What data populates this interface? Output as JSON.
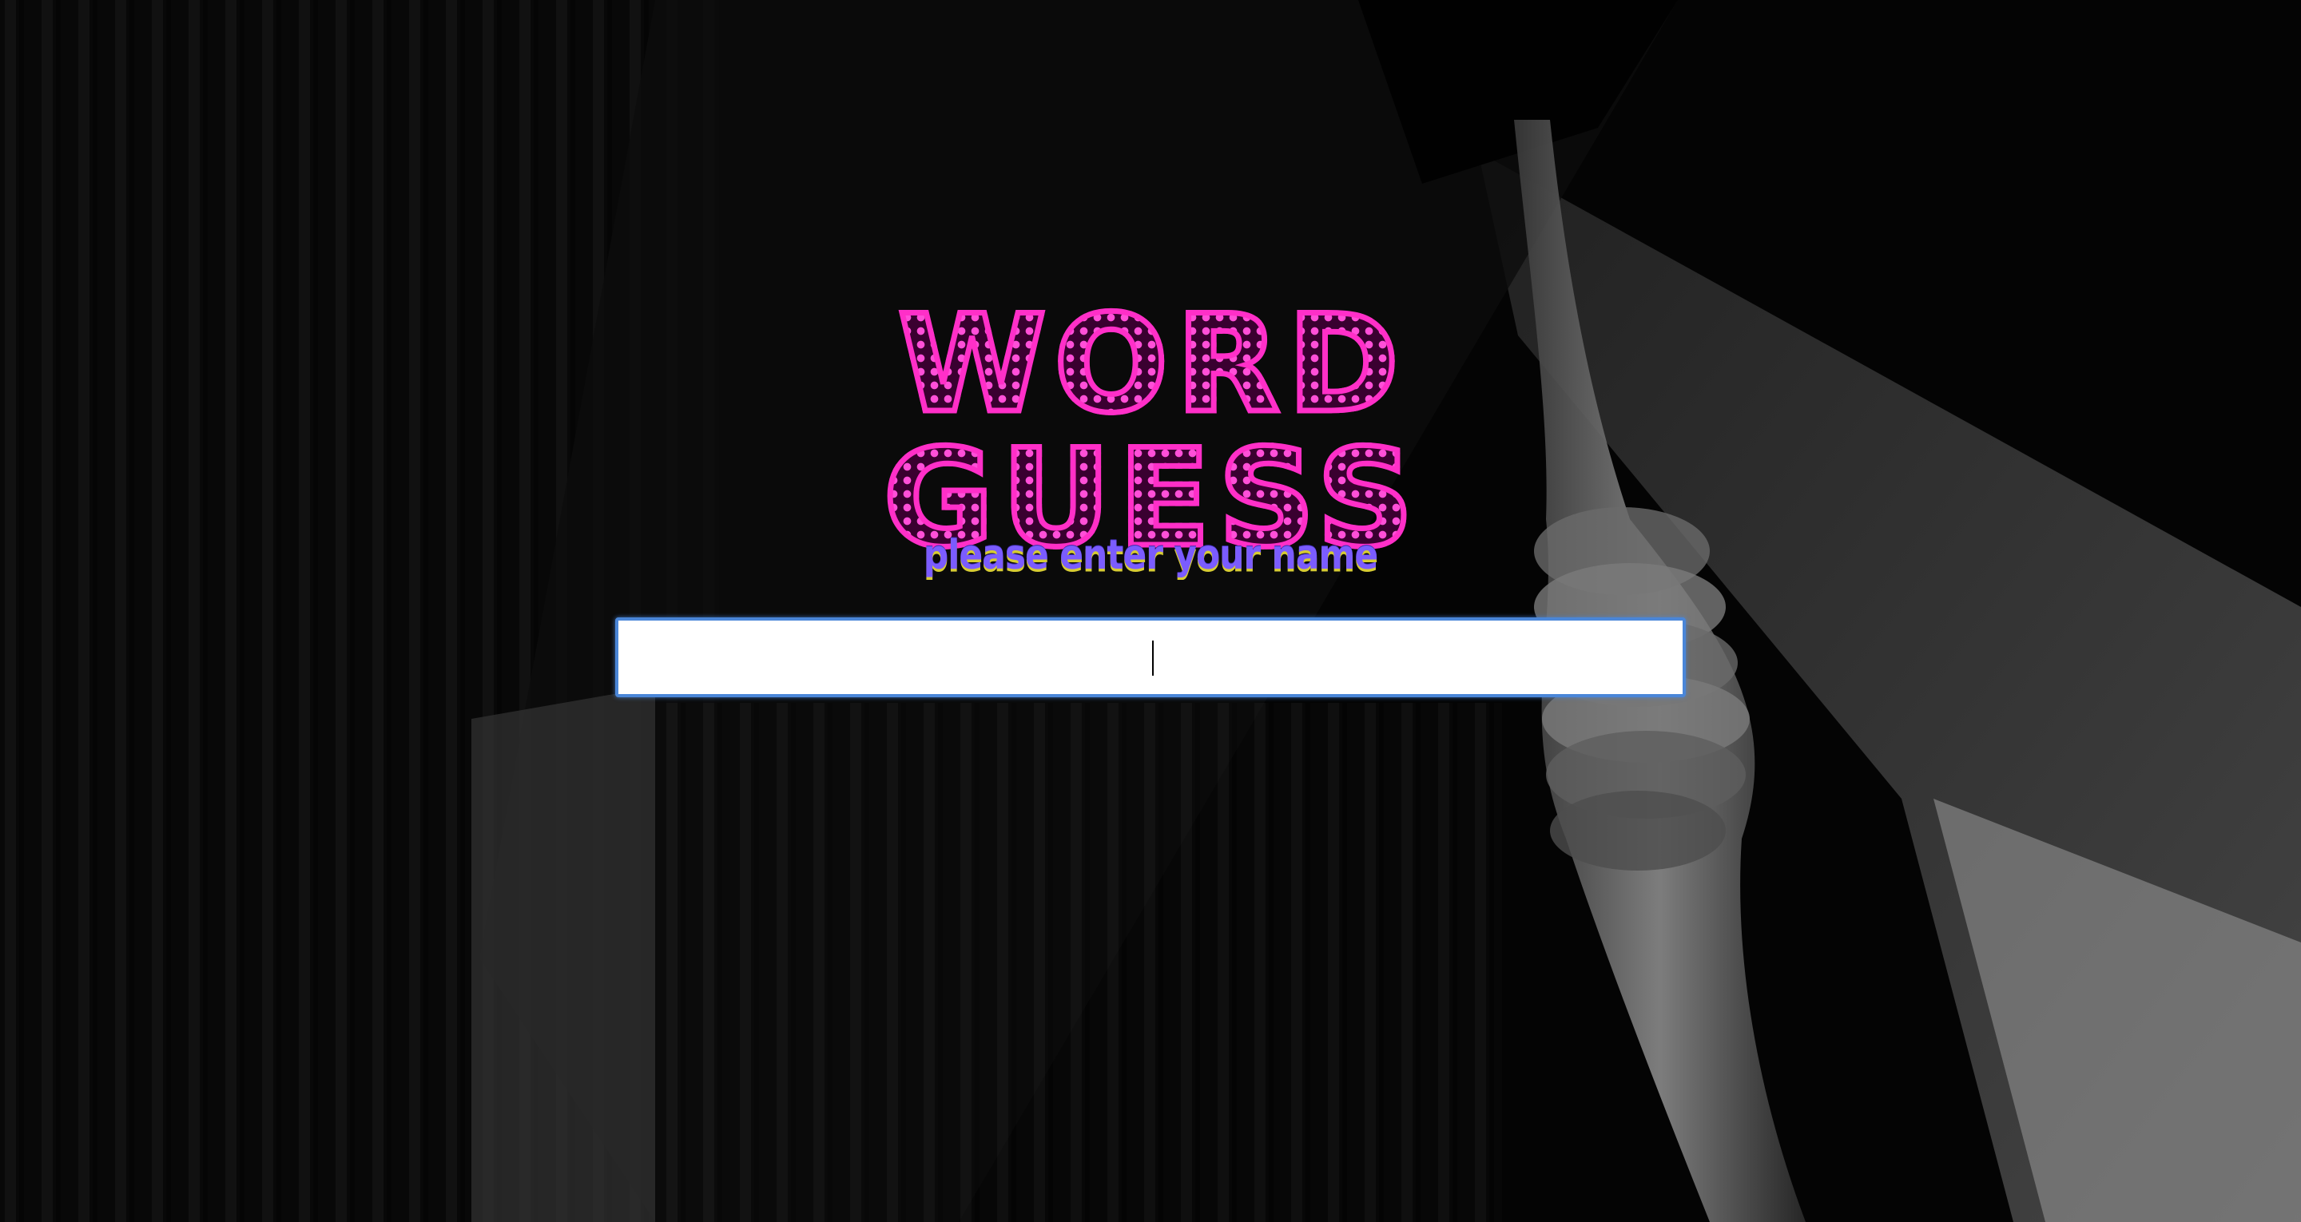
{
  "title": "WORD GUESS",
  "subtitle": "please enter your name",
  "name_input": {
    "value": "",
    "placeholder": ""
  },
  "colors": {
    "title_pink": "#ff2fc8",
    "subtitle_purple": "#7b5cff",
    "subtitle_shadow": "#d7cc33",
    "input_border": "#4a86d8",
    "background": "#050505"
  },
  "background_image": "dark-curtain-with-noose"
}
